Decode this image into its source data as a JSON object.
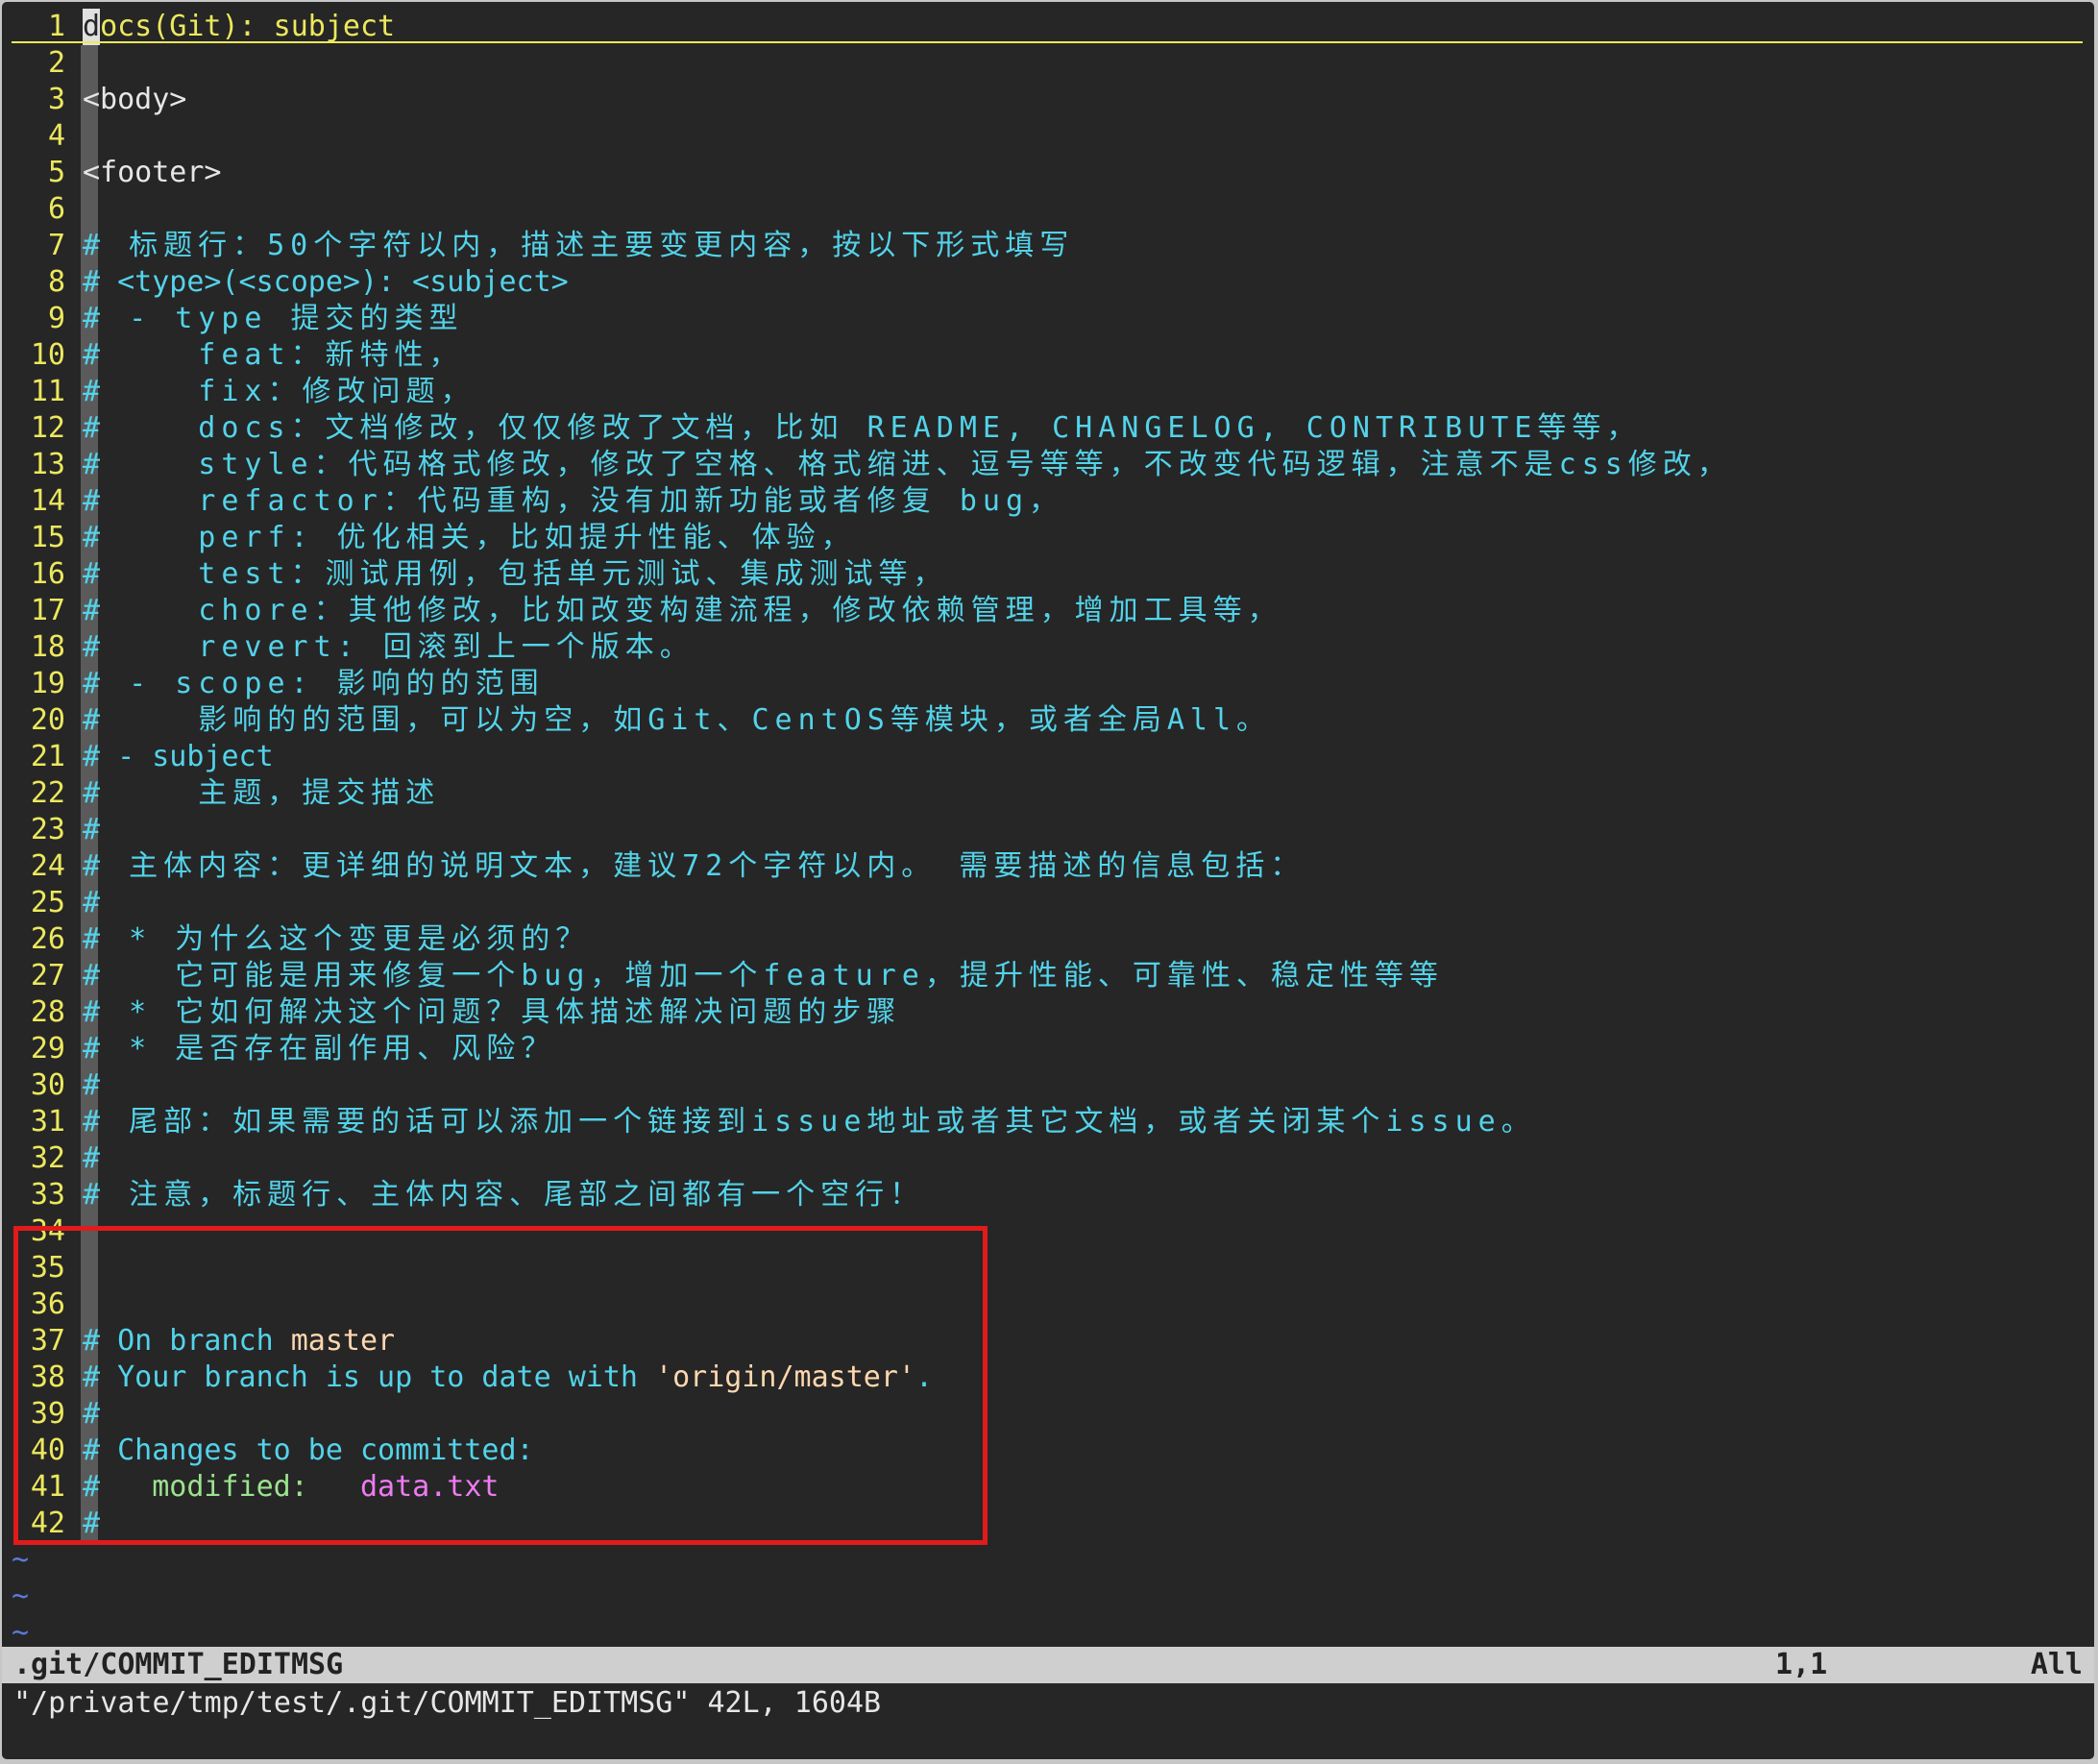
{
  "colors": {
    "background": "#262626",
    "line_number": "#ece85d",
    "subject": "#ece85d",
    "comment": "#53d3ea",
    "branch": "#ffd7af",
    "modified_label": "#9be38f",
    "modified_file": "#ee7bf2",
    "annotation_box": "#e11b1b",
    "tilde": "#5b7ad8"
  },
  "editor": {
    "lines": [
      {
        "num": "1",
        "segments": [
          {
            "t": "d",
            "cls": "cursor"
          },
          {
            "t": "ocs(Git): subject",
            "c": "#ece85d"
          }
        ]
      },
      {
        "num": "2",
        "segments": []
      },
      {
        "num": "3",
        "segments": [
          {
            "t": "<body>",
            "c": "#e6e6e6"
          }
        ]
      },
      {
        "num": "4",
        "segments": []
      },
      {
        "num": "5",
        "segments": [
          {
            "t": "<footer>",
            "c": "#e6e6e6"
          }
        ]
      },
      {
        "num": "6",
        "segments": []
      },
      {
        "num": "7",
        "segments": [
          {
            "t": "# 标题行：50个字符以内，描述主要变更内容，按以下形式填写",
            "c": "#53d3ea"
          }
        ]
      },
      {
        "num": "8",
        "segments": [
          {
            "t": "# <type>(<scope>): <subject>",
            "c": "#53d3ea"
          }
        ]
      },
      {
        "num": "9",
        "segments": [
          {
            "t": "# - type 提交的类型",
            "c": "#53d3ea"
          }
        ]
      },
      {
        "num": "10",
        "segments": [
          {
            "t": "#    feat：新特性，",
            "c": "#53d3ea"
          }
        ]
      },
      {
        "num": "11",
        "segments": [
          {
            "t": "#    fix：修改问题，",
            "c": "#53d3ea"
          }
        ]
      },
      {
        "num": "12",
        "segments": [
          {
            "t": "#    docs：文档修改，仅仅修改了文档，比如 README, CHANGELOG, CONTRIBUTE等等，",
            "c": "#53d3ea"
          }
        ]
      },
      {
        "num": "13",
        "segments": [
          {
            "t": "#    style：代码格式修改，修改了空格、格式缩进、逗号等等，不改变代码逻辑，注意不是css修改，",
            "c": "#53d3ea"
          }
        ]
      },
      {
        "num": "14",
        "segments": [
          {
            "t": "#    refactor：代码重构，没有加新功能或者修复 bug，",
            "c": "#53d3ea"
          }
        ]
      },
      {
        "num": "15",
        "segments": [
          {
            "t": "#    perf: 优化相关，比如提升性能、体验，",
            "c": "#53d3ea"
          }
        ]
      },
      {
        "num": "16",
        "segments": [
          {
            "t": "#    test：测试用例，包括单元测试、集成测试等，",
            "c": "#53d3ea"
          }
        ]
      },
      {
        "num": "17",
        "segments": [
          {
            "t": "#    chore：其他修改，比如改变构建流程，修改依赖管理，增加工具等，",
            "c": "#53d3ea"
          }
        ]
      },
      {
        "num": "18",
        "segments": [
          {
            "t": "#    revert: 回滚到上一个版本。",
            "c": "#53d3ea"
          }
        ]
      },
      {
        "num": "19",
        "segments": [
          {
            "t": "# - scope: 影响的的范围",
            "c": "#53d3ea"
          }
        ]
      },
      {
        "num": "20",
        "segments": [
          {
            "t": "#    影响的的范围，可以为空，如Git、CentOS等模块，或者全局All。",
            "c": "#53d3ea"
          }
        ]
      },
      {
        "num": "21",
        "segments": [
          {
            "t": "# - subject",
            "c": "#53d3ea"
          }
        ]
      },
      {
        "num": "22",
        "segments": [
          {
            "t": "#    主题，提交描述",
            "c": "#53d3ea"
          }
        ]
      },
      {
        "num": "23",
        "segments": [
          {
            "t": "#",
            "c": "#53d3ea"
          }
        ]
      },
      {
        "num": "24",
        "segments": [
          {
            "t": "# 主体内容：更详细的说明文本，建议72个字符以内。 需要描述的信息包括：",
            "c": "#53d3ea"
          }
        ]
      },
      {
        "num": "25",
        "segments": [
          {
            "t": "#",
            "c": "#53d3ea"
          }
        ]
      },
      {
        "num": "26",
        "segments": [
          {
            "t": "# * 为什么这个变更是必须的？",
            "c": "#53d3ea"
          }
        ]
      },
      {
        "num": "27",
        "segments": [
          {
            "t": "#   它可能是用来修复一个bug，增加一个feature，提升性能、可靠性、稳定性等等",
            "c": "#53d3ea"
          }
        ]
      },
      {
        "num": "28",
        "segments": [
          {
            "t": "# * 它如何解决这个问题？具体描述解决问题的步骤",
            "c": "#53d3ea"
          }
        ]
      },
      {
        "num": "29",
        "segments": [
          {
            "t": "# * 是否存在副作用、风险？",
            "c": "#53d3ea"
          }
        ]
      },
      {
        "num": "30",
        "segments": [
          {
            "t": "#",
            "c": "#53d3ea"
          }
        ]
      },
      {
        "num": "31",
        "segments": [
          {
            "t": "# 尾部：如果需要的话可以添加一个链接到issue地址或者其它文档，或者关闭某个issue。",
            "c": "#53d3ea"
          }
        ]
      },
      {
        "num": "32",
        "segments": [
          {
            "t": "#",
            "c": "#53d3ea"
          }
        ]
      },
      {
        "num": "33",
        "segments": [
          {
            "t": "# 注意，标题行、主体内容、尾部之间都有一个空行！",
            "c": "#53d3ea"
          }
        ]
      },
      {
        "num": "34",
        "segments": []
      },
      {
        "num": "35",
        "segments": []
      },
      {
        "num": "36",
        "segments": []
      },
      {
        "num": "37",
        "segments": [
          {
            "t": "# On branch ",
            "c": "#53d3ea"
          },
          {
            "t": "master",
            "c": "#ffd7af"
          }
        ]
      },
      {
        "num": "38",
        "segments": [
          {
            "t": "# Your branch is up to date with ",
            "c": "#53d3ea"
          },
          {
            "t": "'origin/master'",
            "c": "#ffd7af"
          },
          {
            "t": ".",
            "c": "#53d3ea"
          }
        ]
      },
      {
        "num": "39",
        "segments": [
          {
            "t": "#",
            "c": "#53d3ea"
          }
        ]
      },
      {
        "num": "40",
        "segments": [
          {
            "t": "# Changes to be committed:",
            "c": "#53d3ea"
          }
        ]
      },
      {
        "num": "41",
        "segments": [
          {
            "t": "#   ",
            "c": "#53d3ea"
          },
          {
            "t": "modified:",
            "c": "#9be38f"
          },
          {
            "t": "   ",
            "c": "#53d3ea"
          },
          {
            "t": "data.txt",
            "c": "#ee7bf2"
          }
        ]
      },
      {
        "num": "42",
        "segments": [
          {
            "t": "#",
            "c": "#53d3ea"
          }
        ]
      }
    ],
    "tildes": [
      "~",
      "~",
      "~"
    ]
  },
  "status_bar": {
    "filename": ".git/COMMIT_EDITMSG",
    "position": "1,1",
    "scroll": "All"
  },
  "message_line": "\"/private/tmp/test/.git/COMMIT_EDITMSG\" 42L, 1604B"
}
